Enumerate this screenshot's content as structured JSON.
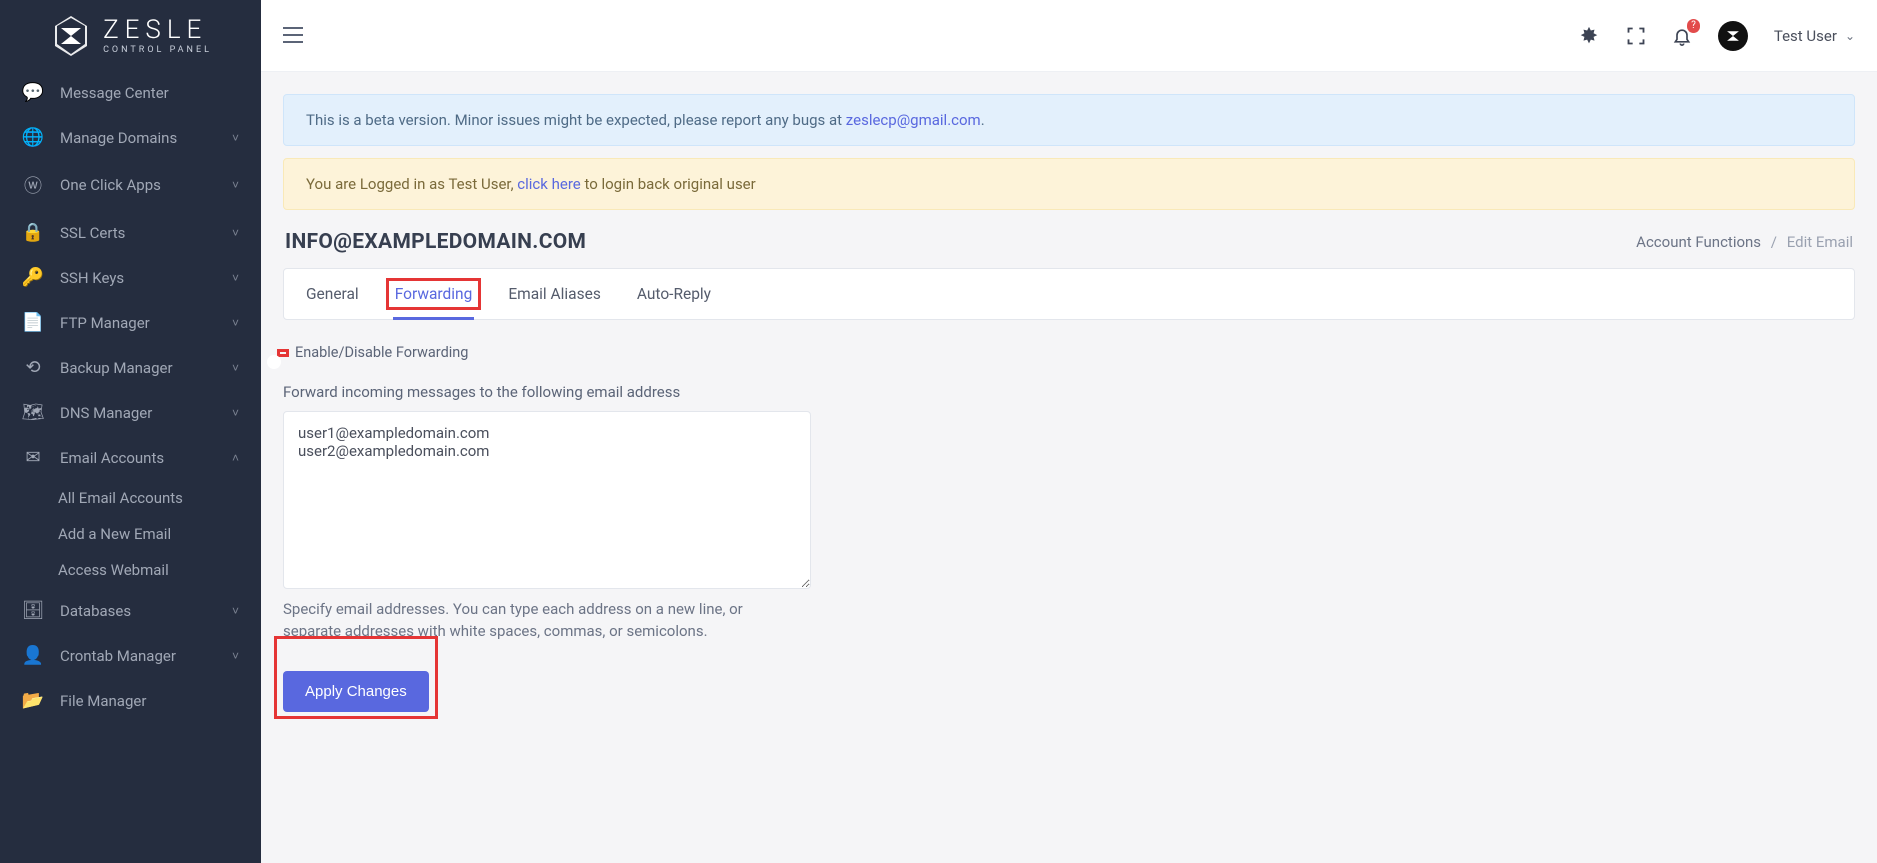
{
  "brand": {
    "name": "ZESLE",
    "subtitle": "CONTROL PANEL"
  },
  "sidebar": {
    "items": [
      {
        "icon": "chat-icon",
        "label": "Message Center",
        "expandable": false
      },
      {
        "icon": "globe-icon",
        "label": "Manage Domains",
        "expandable": true
      },
      {
        "icon": "wordpress-icon",
        "label": "One Click Apps",
        "expandable": true
      },
      {
        "icon": "lock-icon",
        "label": "SSL Certs",
        "expandable": true
      },
      {
        "icon": "key-icon",
        "label": "SSH Keys",
        "expandable": true
      },
      {
        "icon": "file-icon",
        "label": "FTP Manager",
        "expandable": true
      },
      {
        "icon": "history-icon",
        "label": "Backup Manager",
        "expandable": true
      },
      {
        "icon": "sitemap-icon",
        "label": "DNS Manager",
        "expandable": true
      },
      {
        "icon": "mail-icon",
        "label": "Email Accounts",
        "expandable": true,
        "open": true,
        "children": [
          {
            "label": "All Email Accounts"
          },
          {
            "label": "Add a New Email"
          },
          {
            "label": "Access Webmail"
          }
        ]
      },
      {
        "icon": "database-icon",
        "label": "Databases",
        "expandable": true
      },
      {
        "icon": "user-cog-icon",
        "label": "Crontab Manager",
        "expandable": true
      },
      {
        "icon": "folder-icon",
        "label": "File Manager",
        "expandable": false
      }
    ]
  },
  "topbar": {
    "notif_badge": "?",
    "user_name": "Test User"
  },
  "alerts": {
    "beta_pre": "This is a beta version. Minor issues might be expected, please report any bugs at ",
    "beta_link": "zeslecp@gmail.com",
    "beta_post": ".",
    "impersonate_pre": "You are Logged in as Test User, ",
    "impersonate_link": "click here",
    "impersonate_post": " to login back original user"
  },
  "page": {
    "title": "INFO@EXAMPLEDOMAIN.COM",
    "breadcrumb_root": "Account Functions",
    "breadcrumb_current": "Edit Email"
  },
  "tabs": [
    {
      "label": "General",
      "active": false
    },
    {
      "label": "Forwarding",
      "active": true
    },
    {
      "label": "Email Aliases",
      "active": false
    },
    {
      "label": "Auto-Reply",
      "active": false
    }
  ],
  "form": {
    "toggle_label": "Enable/Disable Forwarding",
    "toggle_on": true,
    "forward_label": "Forward incoming messages to the following email address",
    "forward_value": "user1@exampledomain.com\nuser2@exampledomain.com",
    "help_text": "Specify email addresses. You can type each address on a new line, or separate addresses with white spaces, commas, or semicolons.",
    "submit_label": "Apply Changes"
  }
}
